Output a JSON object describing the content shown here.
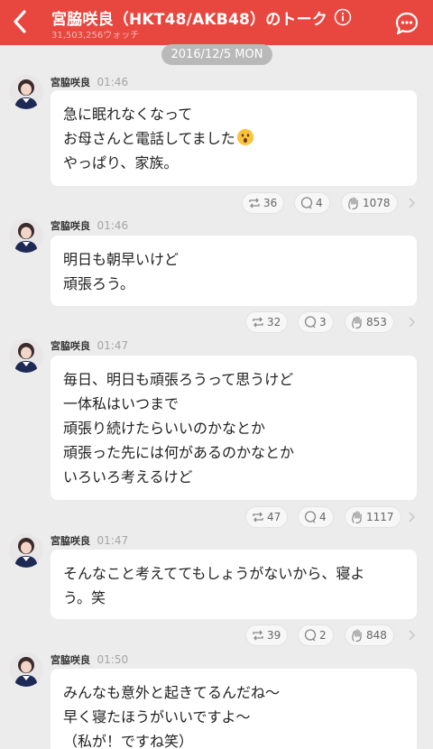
{
  "header": {
    "title": "宮脇咲良（HKT48/AKB48）のトーク",
    "watchers": "31,503,256ウォッチ",
    "accent": "#e8473f"
  },
  "date_label": "2016/12/5 MON",
  "posts": [
    {
      "author": "宮脇咲良",
      "time": "01:46",
      "lines": [
        "急に眠れなくなって",
        "お母さんと電話してました",
        "やっぱり、家族。"
      ],
      "emoji": "astonished-face",
      "reposts": "36",
      "comments": "4",
      "likes": "1078"
    },
    {
      "author": "宮脇咲良",
      "time": "01:46",
      "lines": [
        "明日も朝早いけど",
        "頑張ろう。"
      ],
      "reposts": "32",
      "comments": "3",
      "likes": "853"
    },
    {
      "author": "宮脇咲良",
      "time": "01:47",
      "lines": [
        "毎日、明日も頑張ろうって思うけど",
        "一体私はいつまで",
        "頑張り続けたらいいのかなとか",
        "頑張った先には何があるのかなとか",
        "いろいろ考えるけど"
      ],
      "reposts": "47",
      "comments": "4",
      "likes": "1117"
    },
    {
      "author": "宮脇咲良",
      "time": "01:47",
      "lines": [
        "そんなこと考えててもしょうがないから、寝よ",
        "う。笑"
      ],
      "reposts": "39",
      "comments": "2",
      "likes": "848"
    },
    {
      "author": "宮脇咲良",
      "time": "01:50",
      "lines": [
        "みんなも意外と起きてるんだね〜",
        "早く寝たほうがいいですよ〜",
        "（私が！ですね笑）"
      ]
    }
  ]
}
